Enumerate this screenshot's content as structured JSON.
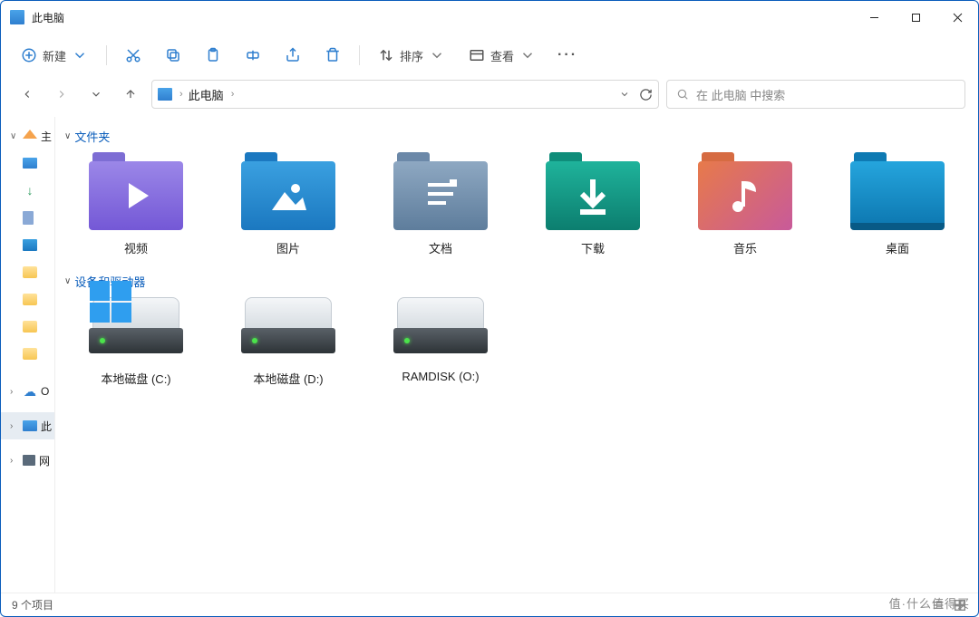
{
  "window": {
    "title": "此电脑"
  },
  "toolbar": {
    "new": "新建",
    "sort": "排序",
    "view": "查看"
  },
  "address": {
    "crumb": "此电脑"
  },
  "search": {
    "placeholder": "在 此电脑 中搜索"
  },
  "sidebar": {
    "home": "主",
    "onedrive": "O",
    "thispc": "此",
    "network": "网"
  },
  "groups": {
    "folders_label": "文件夹",
    "drives_label": "设备和驱动器"
  },
  "folders": [
    {
      "name": "视频"
    },
    {
      "name": "图片"
    },
    {
      "name": "文档"
    },
    {
      "name": "下载"
    },
    {
      "name": "音乐"
    },
    {
      "name": "桌面"
    }
  ],
  "drives": [
    {
      "name": "本地磁盘 (C:)",
      "system": true
    },
    {
      "name": "本地磁盘 (D:)",
      "system": false
    },
    {
      "name": "RAMDISK (O:)",
      "system": false
    }
  ],
  "status": {
    "count": "9 个项目"
  },
  "watermark": "值·什么值得买"
}
